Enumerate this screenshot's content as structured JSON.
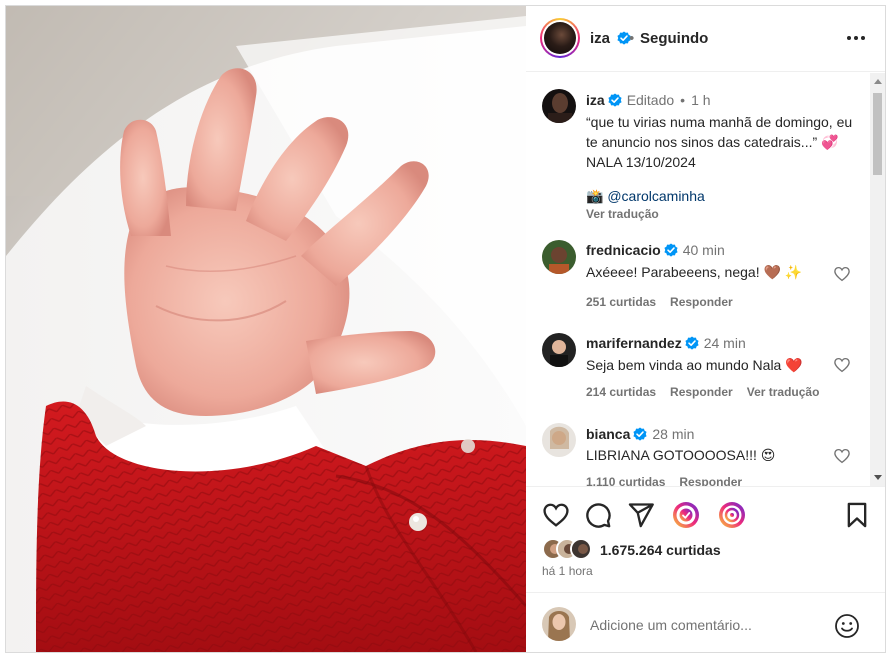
{
  "header": {
    "username": "iza",
    "separator": "•",
    "follow_status": "Seguindo"
  },
  "caption": {
    "username": "iza",
    "edited": "Editado",
    "dot": "•",
    "time": "1 h",
    "text": "“que tu virias numa manhã de domingo, eu te anuncio nos sinos das catedrais...” 💞 NALA 13/10/2024",
    "credit": "📸 @carolcaminha",
    "translate": "Ver tradução"
  },
  "comments": [
    {
      "username": "frednicacio",
      "time": "40 min",
      "text": "Axéeee! Parabeeens, nega! 🤎 ✨",
      "likes": "251 curtidas",
      "reply": "Responder",
      "translate": ""
    },
    {
      "username": "marifernandez",
      "time": "24 min",
      "text": "Seja bem vinda ao mundo Nala ❤️",
      "likes": "214 curtidas",
      "reply": "Responder",
      "translate": "Ver tradução"
    },
    {
      "username": "bianca",
      "time": "28 min",
      "text": "LIBRIANA GOTOOOOSA!!! 😍",
      "likes": "1.110 curtidas",
      "reply": "Responder",
      "translate": ""
    }
  ],
  "actions": {
    "likes": "1.675.264 curtidas",
    "posted": "há 1 hora"
  },
  "add_comment": {
    "placeholder": "Adicione um comentário..."
  },
  "icons": {
    "verified": "verified-badge-icon",
    "more": "more-options-icon",
    "like": "heart-icon",
    "comment": "comment-icon",
    "share": "share-icon",
    "repost": "repost-icon",
    "remix": "remix-icon",
    "save": "bookmark-icon",
    "emoji": "emoji-icon"
  },
  "colors": {
    "verified": "#0095f6",
    "link": "#00376b",
    "muted": "#737373"
  }
}
